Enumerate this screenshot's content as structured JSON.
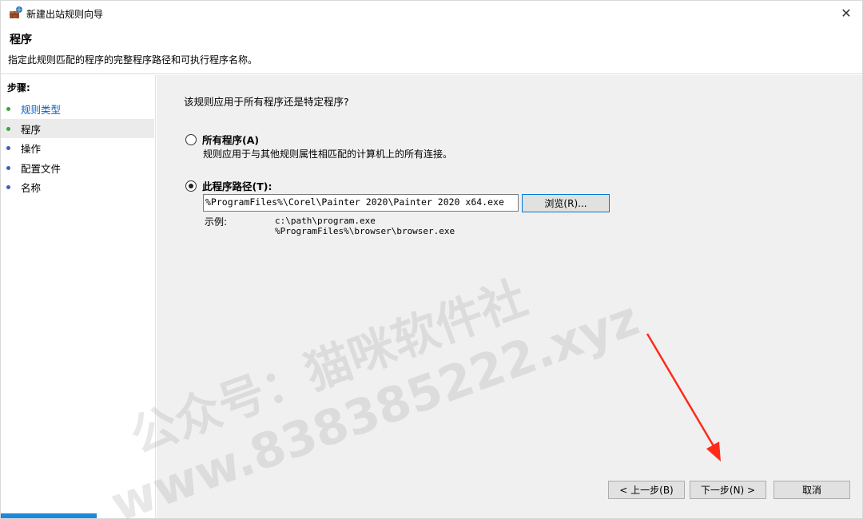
{
  "window": {
    "title": "新建出站规则向导",
    "close_glyph": "✕"
  },
  "header": {
    "title": "程序",
    "description": "指定此规则匹配的程序的完整程序路径和可执行程序名称。"
  },
  "sidebar": {
    "steps_label": "步骤:",
    "items": [
      {
        "label": "规则类型",
        "state": "done",
        "bullet_color": "#3aa43a"
      },
      {
        "label": "程序",
        "state": "current",
        "bullet_color": "#3aa43a"
      },
      {
        "label": "操作",
        "state": "pending",
        "bullet_color": "#3d5fb8"
      },
      {
        "label": "配置文件",
        "state": "pending",
        "bullet_color": "#3d5fb8"
      },
      {
        "label": "名称",
        "state": "pending",
        "bullet_color": "#3d5fb8"
      }
    ]
  },
  "main": {
    "question": "该规则应用于所有程序还是特定程序?",
    "option_all": {
      "label": "所有程序(A)",
      "description": "规则应用于与其他规则属性相匹配的计算机上的所有连接。",
      "checked": false
    },
    "option_path": {
      "label": "此程序路径(T):",
      "checked": true,
      "value": "%ProgramFiles%\\Corel\\Painter 2020\\Painter 2020 x64.exe"
    },
    "browse_label": "浏览(R)...",
    "example_label": "示例:",
    "example_values": [
      "c:\\path\\program.exe",
      "%ProgramFiles%\\browser\\browser.exe"
    ]
  },
  "buttons": {
    "back": "< 上一步(B)",
    "next": "下一步(N) >",
    "cancel": "取消"
  },
  "watermark": {
    "line1": "公众号：猫咪软件社",
    "line2": "www.838385222.xyz"
  },
  "colors": {
    "accent": "#0078d7",
    "link": "#0b5fc5",
    "annotation_arrow": "#ff2a1a"
  }
}
